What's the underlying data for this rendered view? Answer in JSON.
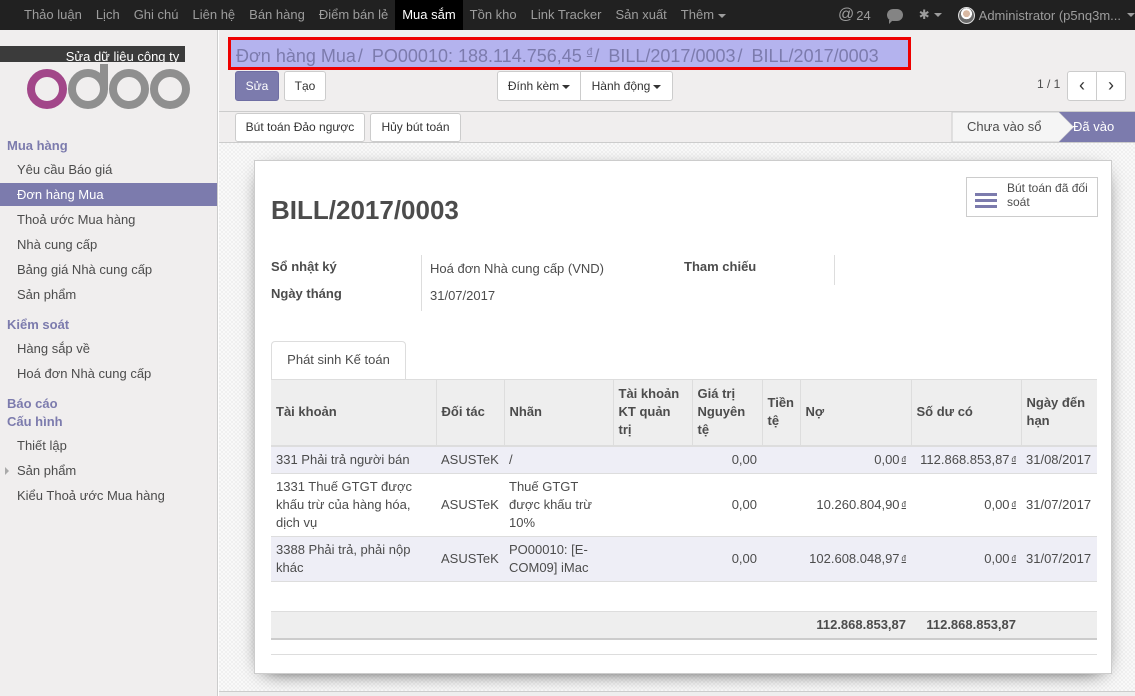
{
  "topbar": {
    "menu": [
      {
        "label": "Thảo luận"
      },
      {
        "label": "Lịch"
      },
      {
        "label": "Ghi chú"
      },
      {
        "label": "Liên hệ"
      },
      {
        "label": "Bán hàng"
      },
      {
        "label": "Điểm bán lẻ"
      },
      {
        "label": "Mua sắm",
        "active": true
      },
      {
        "label": "Tồn kho"
      },
      {
        "label": "Link Tracker"
      },
      {
        "label": "Sản xuất"
      },
      {
        "label": "Thêm"
      }
    ],
    "mentions_icon": "@",
    "mentions_count": "24",
    "chat_icon": "chat-icon",
    "debug_icon": "bug-icon",
    "user_name": "Administrator (p5nq3m..."
  },
  "sidebar": {
    "company_edit_label": "Sửa dữ liệu công ty",
    "logo_text": "odoo",
    "sections": [
      {
        "title": "Mua hàng",
        "items": [
          "Yêu cầu Báo giá",
          "Đơn hàng Mua",
          "Thoả ước Mua hàng",
          "Nhà cung cấp",
          "Bảng giá Nhà cung cấp",
          "Sản phẩm"
        ]
      },
      {
        "title": "Kiểm soát",
        "items": [
          "Hàng sắp về",
          "Hoá đơn Nhà cung cấp"
        ]
      },
      {
        "title": "Báo cáo",
        "items": []
      },
      {
        "title": "Cấu hình",
        "items": [
          "Thiết lập",
          "Sản phẩm",
          "Kiểu Thoả ước Mua hàng"
        ]
      }
    ],
    "active_item": "Đơn hàng Mua"
  },
  "breadcrumb": {
    "items": [
      "Đơn hàng Mua",
      "PO00010: 188.114.756,45",
      "BILL/2017/0003"
    ],
    "currency_symbol": "đ",
    "current": "BILL/2017/0003"
  },
  "toolbar": {
    "edit_label": "Sửa",
    "create_label": "Tạo",
    "attach_label": "Đính kèm",
    "action_label": "Hành động",
    "pager": "1 / 1",
    "prev_icon": "‹",
    "next_icon": "›"
  },
  "statusbar": {
    "reverse_button": "Bút toán Đảo ngược",
    "cancel_button": "Hủy bút toán",
    "stages": [
      {
        "label": "Chưa vào sổ",
        "active": false
      },
      {
        "label": "Đã vào sổ",
        "active": true
      }
    ]
  },
  "form": {
    "reconciled_button": "Bút toán đã đối soát",
    "title": "BILL/2017/0003",
    "fields": {
      "journal_label": "Sổ nhật ký",
      "journal_value": "Hoá đơn Nhà cung cấp (VND)",
      "date_label": "Ngày tháng",
      "date_value": "31/07/2017",
      "ref_label": "Tham chiếu",
      "ref_value": ""
    },
    "tab_label": "Phát sinh Kế toán",
    "table": {
      "headers": [
        "Tài khoản",
        "Đối tác",
        "Nhãn",
        "Tài khoản KT quản trị",
        "Giá trị Nguyên tệ",
        "Tiền tệ",
        "Nợ",
        "Số dư có",
        "Ngày đến hạn"
      ],
      "currency_symbol": "đ",
      "rows": [
        {
          "account": "331 Phải trả người bán",
          "partner": "ASUSTeK",
          "label": "/",
          "analytic": "",
          "amount_currency": "0,00",
          "currency": "",
          "debit": "0,00",
          "credit": "112.868.853,87",
          "due_date": "31/08/2017"
        },
        {
          "account": "1331 Thuế GTGT được khấu trừ của hàng hóa, dịch vụ",
          "partner": "ASUSTeK",
          "label": "Thuế GTGT được khấu trừ 10%",
          "analytic": "",
          "amount_currency": "0,00",
          "currency": "",
          "debit": "10.260.804,90",
          "credit": "0,00",
          "due_date": "31/07/2017"
        },
        {
          "account": "3388 Phải trả, phải nộp khác",
          "partner": "ASUSTeK",
          "label": "PO00010: [E-COM09] iMac",
          "analytic": "",
          "amount_currency": "0,00",
          "currency": "",
          "debit": "102.608.048,97",
          "credit": "0,00",
          "due_date": "31/07/2017"
        }
      ],
      "totals": {
        "debit": "112.868.853,87",
        "credit": "112.868.853,87"
      }
    }
  }
}
